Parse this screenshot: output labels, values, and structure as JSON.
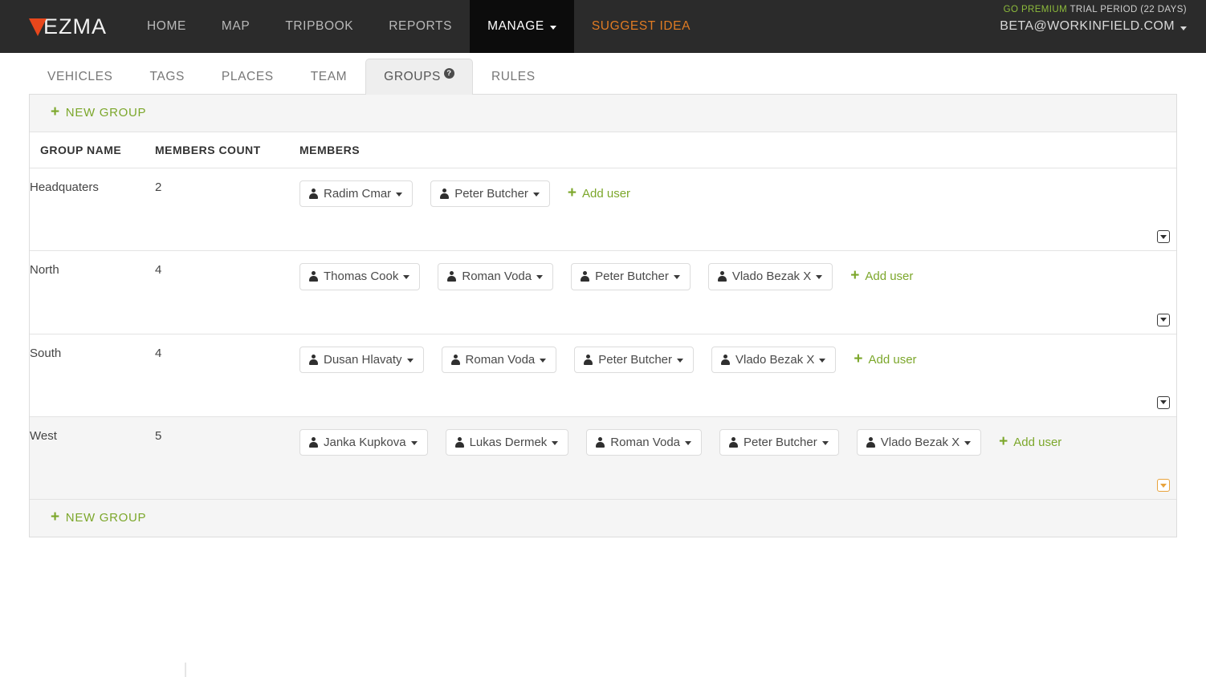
{
  "brand": {
    "name": "VEZMA",
    "accent": "#e8471c"
  },
  "topnav": {
    "items": [
      {
        "label": "HOME",
        "active": false,
        "accent": false,
        "caret": false
      },
      {
        "label": "MAP",
        "active": false,
        "accent": false,
        "caret": false
      },
      {
        "label": "TRIPBOOK",
        "active": false,
        "accent": false,
        "caret": false
      },
      {
        "label": "REPORTS",
        "active": false,
        "accent": false,
        "caret": false
      },
      {
        "label": "MANAGE",
        "active": true,
        "accent": false,
        "caret": true
      },
      {
        "label": "SUGGEST IDEA",
        "active": false,
        "accent": true,
        "caret": false
      }
    ],
    "promo_go": "GO PREMIUM",
    "promo_trial": "TRIAL PERIOD (22 DAYS)",
    "email": "BETA@WORKINFIELD.COM"
  },
  "tabs": [
    {
      "label": "VEHICLES",
      "active": false,
      "help": false
    },
    {
      "label": "TAGS",
      "active": false,
      "help": false
    },
    {
      "label": "PLACES",
      "active": false,
      "help": false
    },
    {
      "label": "TEAM",
      "active": false,
      "help": false
    },
    {
      "label": "GROUPS",
      "active": true,
      "help": true
    },
    {
      "label": "RULES",
      "active": false,
      "help": false
    }
  ],
  "help_glyph": "?",
  "new_group_label": "NEW GROUP",
  "plus_glyph": "+",
  "add_user_label": "Add user",
  "table": {
    "headers": [
      "GROUP NAME",
      "MEMBERS COUNT",
      "MEMBERS"
    ],
    "rows": [
      {
        "name": "Headquaters",
        "count": "2",
        "members": [
          "Radim Cmar",
          "Peter Butcher"
        ],
        "hover": false,
        "toggle_accent": false
      },
      {
        "name": "North",
        "count": "4",
        "members": [
          "Thomas Cook",
          "Roman Voda",
          "Peter Butcher",
          "Vlado Bezak X"
        ],
        "hover": false,
        "toggle_accent": false
      },
      {
        "name": "South",
        "count": "4",
        "members": [
          "Dusan Hlavaty",
          "Roman Voda",
          "Peter Butcher",
          "Vlado Bezak X"
        ],
        "hover": false,
        "toggle_accent": false
      },
      {
        "name": "West",
        "count": "5",
        "members": [
          "Janka Kupkova",
          "Lukas Dermek",
          "Roman Voda",
          "Peter Butcher",
          "Vlado Bezak X"
        ],
        "hover": true,
        "toggle_accent": true
      }
    ]
  },
  "colors": {
    "nav_bg": "#2b2b2b",
    "nav_active_bg": "#0c0c0c",
    "green": "#7ca72b",
    "orange": "#e07b23",
    "toggle_accent": "#e8a33d"
  }
}
